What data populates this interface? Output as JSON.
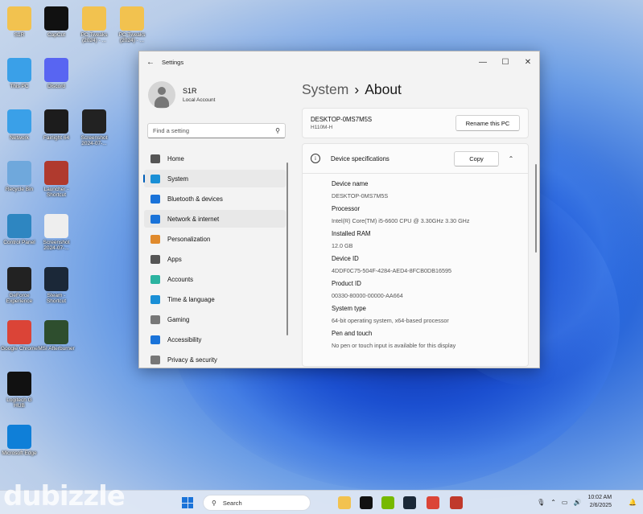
{
  "desktop": {
    "icons": [
      {
        "label": "S1R",
        "icon": "folder-icon",
        "color": "#f2c24f"
      },
      {
        "label": "CapCut",
        "icon": "capcut-icon",
        "color": "#111111"
      },
      {
        "label": "PC Tweaks (2024) - ...",
        "icon": "folder-icon",
        "color": "#f2c24f"
      },
      {
        "label": "PC Tweaks (2024) - ...",
        "icon": "folder-icon",
        "color": "#f2c24f"
      },
      {
        "label": "This PC",
        "icon": "monitor-icon",
        "color": "#3aa0e8"
      },
      {
        "label": "Discord",
        "icon": "discord-icon",
        "color": "#5865f2"
      },
      {
        "label": "Network",
        "icon": "network-icon",
        "color": "#3aa0e8"
      },
      {
        "label": "Fairlight 64",
        "icon": "fairlight-icon",
        "color": "#1c1c1c"
      },
      {
        "label": "Screenshot 2024-07-...",
        "icon": "screenshot-icon",
        "color": "#222222"
      },
      {
        "label": "Recycle Bin",
        "icon": "recycle-bin-icon",
        "color": "#6fa8dc"
      },
      {
        "label": "Launcher - Shortcut",
        "icon": "game-launcher-icon",
        "color": "#b03a2e"
      },
      {
        "label": "Control Panel",
        "icon": "control-panel-icon",
        "color": "#2e86c1"
      },
      {
        "label": "Screenshot 2024-07-...",
        "icon": "screenshot-icon",
        "color": "#eeeeee"
      },
      {
        "label": "GeForce Experience",
        "icon": "geforce-icon",
        "color": "#222222"
      },
      {
        "label": "Steam - Shortcut",
        "icon": "steam-icon",
        "color": "#1b2838"
      },
      {
        "label": "Google Chrome",
        "icon": "chrome-icon",
        "color": "#db4437"
      },
      {
        "label": "MSI Afterburner",
        "icon": "msi-afterburner-icon",
        "color": "#2e4e2e"
      },
      {
        "label": "Logitech G HUB",
        "icon": "logitech-icon",
        "color": "#111111"
      },
      {
        "label": "Microsoft Edge",
        "icon": "edge-icon",
        "color": "#0f7fd8"
      }
    ]
  },
  "settings": {
    "window_title": "Settings",
    "user_name": "S1R",
    "account_type": "Local Account",
    "search_placeholder": "Find a setting",
    "nav": [
      {
        "label": "Home",
        "icon": "home-icon",
        "color": "#555555"
      },
      {
        "label": "System",
        "icon": "system-icon",
        "color": "#1a8fd6"
      },
      {
        "label": "Bluetooth & devices",
        "icon": "bluetooth-icon",
        "color": "#1a73d9"
      },
      {
        "label": "Network & internet",
        "icon": "wifi-icon",
        "color": "#1a73d9"
      },
      {
        "label": "Personalization",
        "icon": "brush-icon",
        "color": "#e08a2c"
      },
      {
        "label": "Apps",
        "icon": "apps-icon",
        "color": "#555555"
      },
      {
        "label": "Accounts",
        "icon": "person-icon",
        "color": "#2bb3a0"
      },
      {
        "label": "Time & language",
        "icon": "globe-clock-icon",
        "color": "#1a8fd6"
      },
      {
        "label": "Gaming",
        "icon": "controller-icon",
        "color": "#777777"
      },
      {
        "label": "Accessibility",
        "icon": "accessibility-icon",
        "color": "#1a73d9"
      },
      {
        "label": "Privacy & security",
        "icon": "shield-icon",
        "color": "#777777"
      }
    ],
    "breadcrumb_parent": "System",
    "breadcrumb_sep": "›",
    "breadcrumb_current": "About",
    "pc_name": "DESKTOP-0MS7M5S",
    "pc_model": "H110M-H",
    "rename_button": "Rename this PC",
    "spec_title": "Device specifications",
    "copy_button": "Copy",
    "specs": [
      {
        "label": "Device name",
        "value": "DESKTOP-0MS7M5S"
      },
      {
        "label": "Processor",
        "value": "Intel(R) Core(TM) i5-6600 CPU @ 3.30GHz   3.30 GHz"
      },
      {
        "label": "Installed RAM",
        "value": "12.0 GB"
      },
      {
        "label": "Device ID",
        "value": "4DDF0C75-504F-4284-AED4-8FCB0DB16595"
      },
      {
        "label": "Product ID",
        "value": "00330-80000-00000-AA664"
      },
      {
        "label": "System type",
        "value": "64-bit operating system, x64-based processor"
      },
      {
        "label": "Pen and touch",
        "value": "No pen or touch input is available for this display"
      }
    ]
  },
  "taskbar": {
    "search_label": "Search",
    "time": "10:02 AM",
    "date": "2/6/2025",
    "apps": [
      "file-explorer-icon",
      "capcut-icon",
      "geforce-icon",
      "steam-icon",
      "chrome-icon",
      "snipping-tool-icon"
    ]
  },
  "watermark": "dubizzle"
}
